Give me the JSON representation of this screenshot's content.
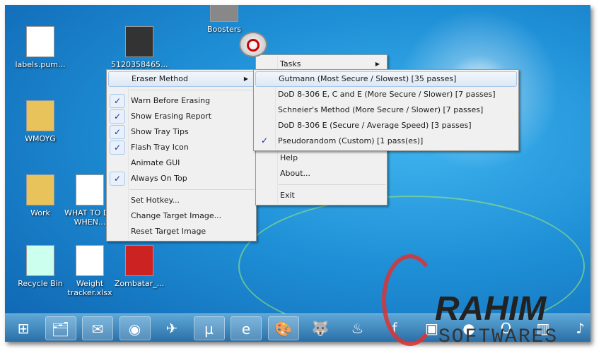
{
  "desktop_icons": [
    {
      "label": "Boosters",
      "color": "#888"
    },
    {
      "label": "labels.pum...",
      "color": "#fff"
    },
    {
      "label": "5120358465...",
      "color": "#333"
    },
    {
      "label": "WMOYG",
      "color": "#e8c25a"
    },
    {
      "label": "Work",
      "color": "#e8c25a"
    },
    {
      "label": "WHAT TO DO WHEN...",
      "color": "#fff"
    },
    {
      "label": "Recycle Bin",
      "color": "#cfe"
    },
    {
      "label": "Weight tracker.xlsx",
      "color": "#fff"
    },
    {
      "label": "Zombatar_...",
      "color": "#c22"
    }
  ],
  "main_menu": {
    "eraser_method": "Eraser Method",
    "items": [
      {
        "label": "Warn Before Erasing",
        "checked": true
      },
      {
        "label": "Show Erasing Report",
        "checked": true
      },
      {
        "label": "Show Tray Tips",
        "checked": true
      },
      {
        "label": "Flash Tray Icon",
        "checked": true
      },
      {
        "label": "Animate GUI",
        "checked": false
      },
      {
        "label": "Always On Top",
        "checked": true
      }
    ],
    "set_hotkey": "Set Hotkey...",
    "change_target": "Change Target Image...",
    "reset_target": "Reset Target Image"
  },
  "tasks_menu": {
    "tasks": "Tasks",
    "help": "Help",
    "about": "About...",
    "exit": "Exit"
  },
  "eraser_submenu": [
    {
      "label": "Gutmann (Most Secure / Slowest) [35 passes]",
      "checked": false
    },
    {
      "label": "DoD 8-306 E, C and E (More Secure / Slower) [7 passes]",
      "checked": false
    },
    {
      "label": "Schneier's Method (More Secure / Slower) [7 passes]",
      "checked": false
    },
    {
      "label": "DoD 8-306 E (Secure / Average Speed) [3 passes]",
      "checked": false
    },
    {
      "label": "Pseudorandom (Custom) [1 pass(es)]",
      "checked": true
    }
  ],
  "check_glyph": "✓",
  "arrow_glyph": "▶",
  "taskbar": [
    {
      "name": "start-button",
      "glyph": "⊞",
      "pinned": false
    },
    {
      "name": "explorer",
      "glyph": "🗂",
      "pinned": true
    },
    {
      "name": "outlook",
      "glyph": "✉",
      "pinned": true
    },
    {
      "name": "chrome",
      "glyph": "◉",
      "pinned": true
    },
    {
      "name": "bird-app",
      "glyph": "✈",
      "pinned": false
    },
    {
      "name": "utorrent",
      "glyph": "µ",
      "pinned": true
    },
    {
      "name": "internet-explorer",
      "glyph": "e",
      "pinned": true
    },
    {
      "name": "paint",
      "glyph": "🎨",
      "pinned": true
    },
    {
      "name": "gimp",
      "glyph": "🐺",
      "pinned": false
    },
    {
      "name": "steam",
      "glyph": "♨",
      "pinned": false
    },
    {
      "name": "flash",
      "glyph": "f",
      "pinned": false
    },
    {
      "name": "app-purple",
      "glyph": "▣",
      "pinned": false
    },
    {
      "name": "app-media",
      "glyph": "●",
      "pinned": false
    },
    {
      "name": "opera",
      "glyph": "O",
      "pinned": false
    },
    {
      "name": "app-glass",
      "glyph": "▥",
      "pinned": false
    },
    {
      "name": "app-tools",
      "glyph": "♪",
      "pinned": false
    }
  ],
  "watermark": {
    "line1": "RAHIM",
    "line2": "SOFTWARES"
  }
}
